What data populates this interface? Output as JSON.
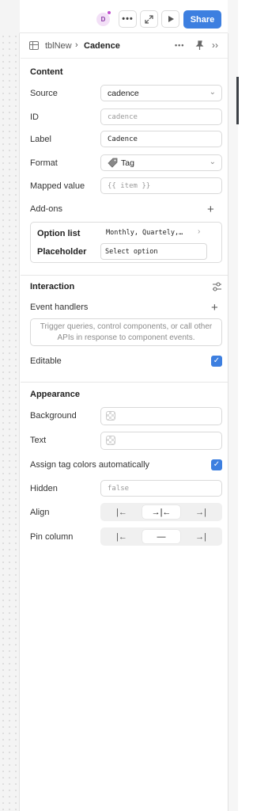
{
  "topbar": {
    "avatar_initial": "D",
    "more_icon": "ellipsis-icon",
    "expand_icon": "expand-icon",
    "play_icon": "play-icon",
    "share_label": "Share",
    "share_color": "#3d7fe0"
  },
  "breadcrumb": {
    "parent": "tblNew",
    "separator": "›",
    "current": "Cadence"
  },
  "content": {
    "title": "Content",
    "source": {
      "label": "Source",
      "value": "cadence"
    },
    "id": {
      "label": "ID",
      "placeholder": "cadence"
    },
    "label": {
      "label": "Label",
      "value": "Cadence"
    },
    "format": {
      "label": "Format",
      "value": "Tag"
    },
    "mapped_value": {
      "label": "Mapped value",
      "placeholder": "{{ item }}"
    },
    "addons": {
      "label": "Add-ons",
      "option_list_label": "Option list",
      "option_list_value": "Monthly, Quartely,…",
      "placeholder_label": "Placeholder",
      "placeholder_value": "Select option"
    }
  },
  "interaction": {
    "title": "Interaction",
    "event_handlers_label": "Event handlers",
    "event_handlers_hint": "Trigger queries, control components, or call other APIs in response to component events.",
    "editable_label": "Editable",
    "editable_checked": true
  },
  "appearance": {
    "title": "Appearance",
    "background_label": "Background",
    "text_label": "Text",
    "assign_colors_label": "Assign tag colors automatically",
    "assign_colors_checked": true,
    "hidden_label": "Hidden",
    "hidden_placeholder": "false",
    "align_label": "Align",
    "align_options": [
      "|←",
      "→|←",
      "→|"
    ],
    "align_selected": "center",
    "pin_label": "Pin column",
    "pin_options": [
      "|←",
      "—",
      "→|"
    ],
    "pin_selected": "none"
  }
}
